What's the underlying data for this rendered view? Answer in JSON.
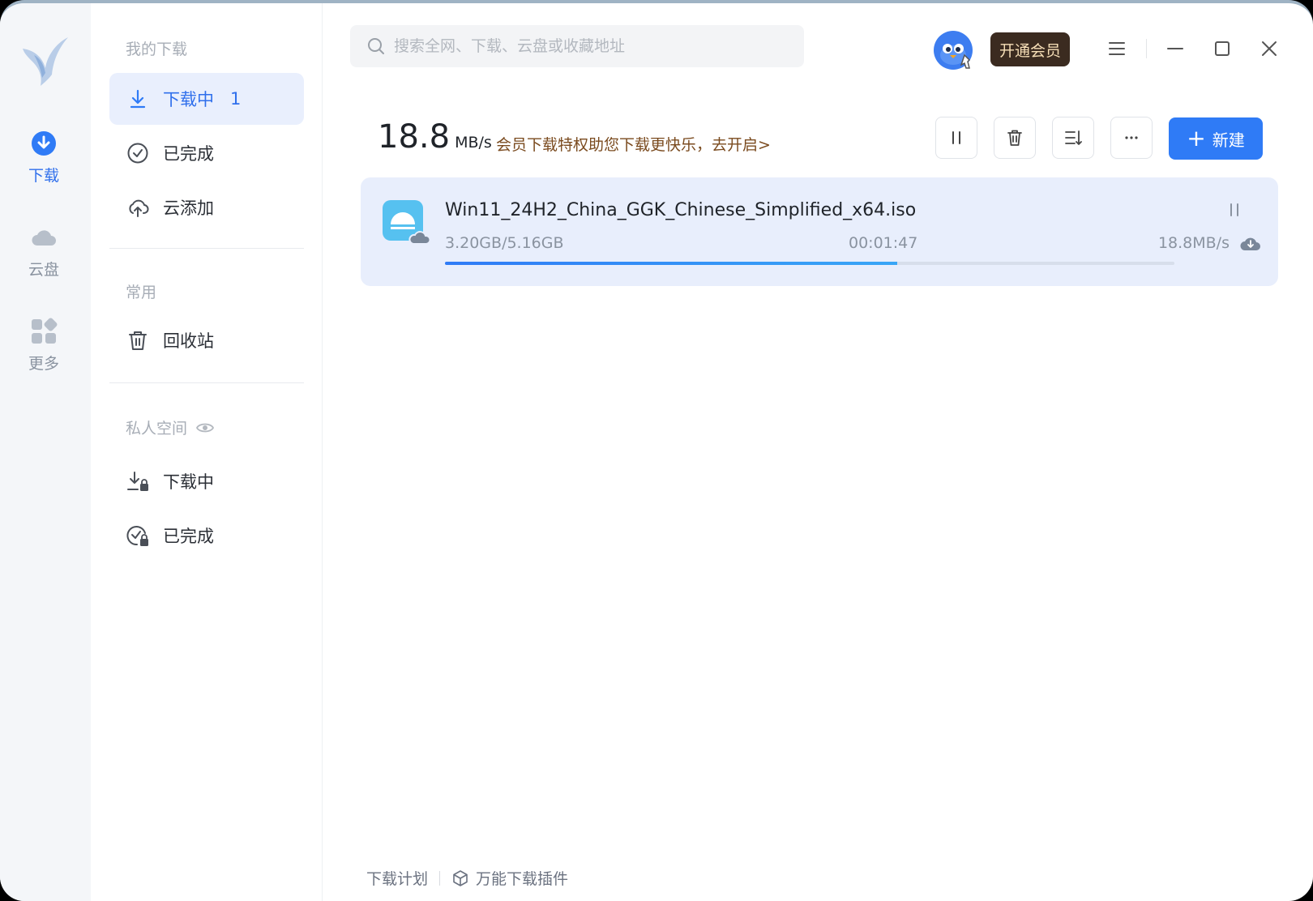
{
  "rail": {
    "items": [
      {
        "label": "下载",
        "icon": "download-circle-icon",
        "active": true
      },
      {
        "label": "云盘",
        "icon": "cloud-icon"
      },
      {
        "label": "更多",
        "icon": "apps-grid-icon"
      }
    ]
  },
  "sidebar": {
    "my_downloads_title": "我的下载",
    "downloading_label": "下载中",
    "downloading_count": "1",
    "completed_label": "已完成",
    "cloud_add_label": "云添加",
    "common_title": "常用",
    "recycle_label": "回收站",
    "private_title": "私人空间",
    "private_downloading_label": "下载中",
    "private_completed_label": "已完成"
  },
  "search": {
    "placeholder": "搜索全网、下载、云盘或收藏地址",
    "value": ""
  },
  "header": {
    "vip_label": "开通会员"
  },
  "toolbar": {
    "speed_value": "18.8",
    "speed_unit": "MB/s",
    "promo_text": "会员下载特权助您下载更快乐，去开启>",
    "new_label": "新建"
  },
  "task": {
    "filename": "Win11_24H2_China_GGK_Chinese_Simplified_x64.iso",
    "progress_text": "3.20GB/5.16GB",
    "elapsed": "00:01:47",
    "speed": "18.8MB/s",
    "progress_fraction": 0.62
  },
  "footer": {
    "plan_label": "下载计划",
    "plugin_label": "万能下载插件"
  },
  "colors": {
    "accent": "#2f7bf6",
    "vip_bg": "#3b2b20",
    "vip_text": "#f7dfb7",
    "promo": "#7a4a1e"
  }
}
